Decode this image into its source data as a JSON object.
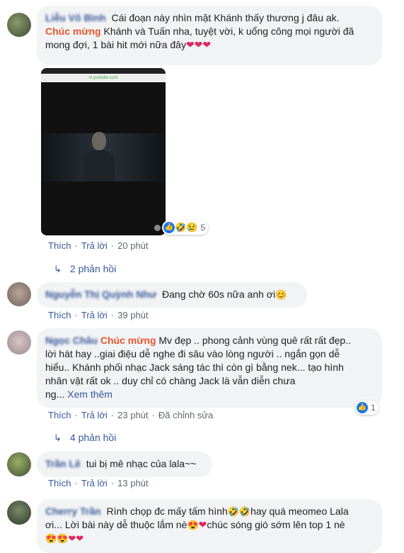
{
  "comments": [
    {
      "user": "Liễu Võ Bình",
      "text_line1": "Cái đoạn này nhìn mặt Khánh thấy thương j đâu ak.",
      "tag": "Chúc mừng",
      "text_line2": " Khánh và Tuấn nha, tuyệt vời, k uổng công mọi người đã",
      "text_line3": "mong đợi, 1 bài hit mới nữa đây",
      "emojis_end": "❤❤❤",
      "reaction_count": "5",
      "actions": {
        "like": "Thích",
        "reply": "Trả lời",
        "time": "20 phút"
      },
      "replies_link": "2 phản hồi"
    },
    {
      "user": "Nguyễn Thị Quỳnh Như",
      "text": "Đang chờ 60s nữa anh ơi",
      "emoji": "😊",
      "actions": {
        "like": "Thích",
        "reply": "Trả lời",
        "time": "39 phút"
      }
    },
    {
      "user": "Ngọc Châu",
      "tag": "Chúc mừng",
      "lines": [
        " Mv đẹp .. phong cảnh vùng quê rất rất đẹp..",
        "lời hát hay ..giai điệu dễ nghe đi sâu vào lòng người .. ngắn gọn dễ",
        "hiểu.. Khánh phối nhạc Jack sáng tác thì còn gì bằng nek... tạo hình",
        "nhân vật rất ok .. duy chỉ có chàng Jack là vẫn diễn chưa"
      ],
      "last_line": "ng...",
      "see_more": "Xem thêm",
      "reaction_count": "1",
      "actions": {
        "like": "Thích",
        "reply": "Trả lời",
        "time": "23 phút",
        "edited": "Đã chỉnh sửa"
      },
      "replies_link": "4 phản hồi"
    },
    {
      "user": "Trần Lê",
      "text": "tui bị mê nhạc của lala~~",
      "actions": {
        "like": "Thích",
        "reply": "Trả lời",
        "time": "13 phút"
      }
    },
    {
      "user": "Cherry Trần",
      "line1": "Rình chọp đc mấy tấm hình",
      "line1b": "hay quá meomeo Lala",
      "line2": "ơi... Lời bài này dễ thuộc lắm nè",
      "line2b": "chúc sóng gió sớm lên top 1 nè",
      "line3_emojis": "😍😍❤❤"
    }
  ],
  "video": {
    "url_text": "m.youtube.com"
  }
}
